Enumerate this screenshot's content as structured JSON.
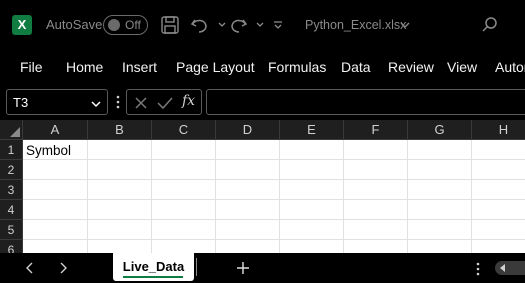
{
  "titlebar": {
    "autosave_label": "AutoSave",
    "autosave_state": "Off",
    "filename": "Python_Excel.xlsx",
    "logo_letter": "X"
  },
  "ribbon": {
    "tabs": [
      "File",
      "Home",
      "Insert",
      "Page Layout",
      "Formulas",
      "Data",
      "Review",
      "View",
      "Autor"
    ]
  },
  "formula_bar": {
    "cell_reference": "T3",
    "fx_label": "fx",
    "formula_value": ""
  },
  "grid": {
    "columns": [
      "A",
      "B",
      "C",
      "D",
      "E",
      "F",
      "G",
      "H"
    ],
    "rows": [
      "1",
      "2",
      "3",
      "4",
      "5",
      "6"
    ],
    "cells": {
      "A1": "Symbol"
    }
  },
  "sheets": {
    "tabs": [
      "Live_Data"
    ],
    "active": "Live_Data"
  },
  "colors": {
    "excel_green": "#107c41",
    "background": "#000000",
    "grid_background": "#ffffff"
  }
}
